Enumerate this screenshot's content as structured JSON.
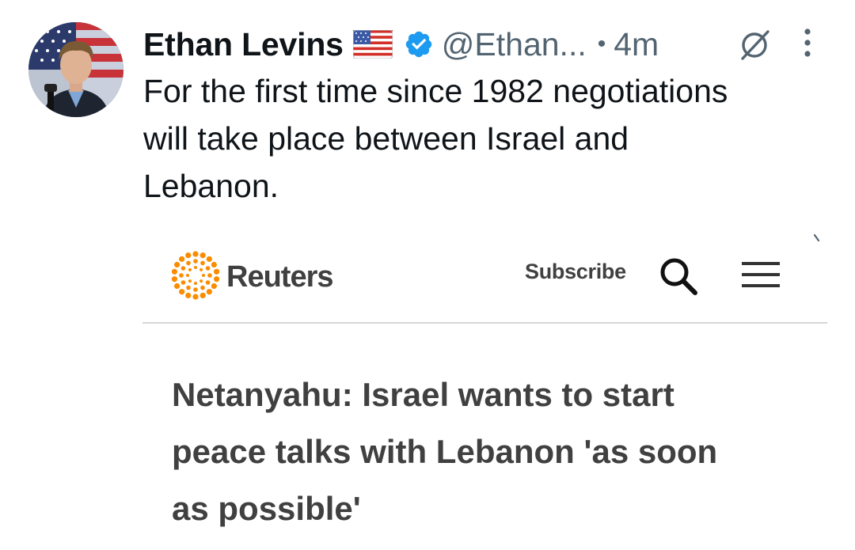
{
  "tweet": {
    "author_name": "Ethan Levins",
    "flag_emoji": "🇺🇸",
    "handle": "@Ethan...",
    "separator": "•",
    "time": "4m",
    "text": "For the first time since 1982 negotiations\nwill take place between Israel and\nLebanon.",
    "verified_color": "#1d9bf0",
    "icons": [
      "avatar",
      "us-flag-icon",
      "verified-badge-icon",
      "grok-icon",
      "more-vertical-icon"
    ]
  },
  "card": {
    "brand": "Reuters",
    "brand_color": "#fb8c00",
    "subscribe_label": "Subscribe",
    "icons": [
      "reuters-logo-icon",
      "search-icon",
      "menu-icon"
    ],
    "headline": "Netanyahu: Israel wants to start\npeace talks with Lebanon 'as soon\nas possible'"
  }
}
